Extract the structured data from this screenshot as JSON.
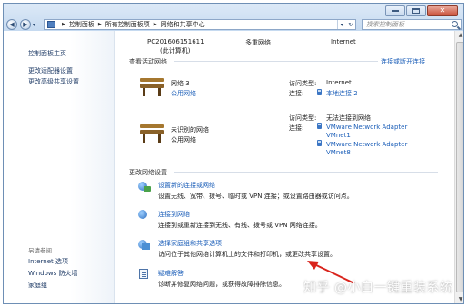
{
  "address_bar": {
    "crumbs": [
      "控制面板",
      "所有控制面板项",
      "网络和共享中心"
    ],
    "refresh_glyph": "↻"
  },
  "search": {
    "placeholder": "搜索控制面板"
  },
  "sidebar": {
    "items": [
      "控制面板主页",
      "更改适配器设置",
      "更改高级共享设置"
    ],
    "see_also_label": "另请参阅",
    "see_also": [
      "Internet 选项",
      "Windows 防火墙",
      "家庭组"
    ]
  },
  "summary_row": {
    "computer": "PC201606151611",
    "computer_note": "(此计算机)",
    "middle": "多重网络",
    "right": "Internet"
  },
  "active_networks": {
    "title": "查看活动网络",
    "connect_link": "连接或断开连接",
    "networks": [
      {
        "name": "网络 3",
        "type": "公用网络",
        "access_label": "访问类型:",
        "access_value": "Internet",
        "conn_label": "连接:",
        "conn_values": [
          "本地连接 2"
        ]
      },
      {
        "name": "未识别的网络",
        "type": "公用网络",
        "access_label": "访问类型:",
        "access_value": "无法连接到网络",
        "conn_label": "连接:",
        "conn_values": [
          "VMware Network Adapter VMnet1",
          "VMware Network Adapter VMnet8"
        ]
      }
    ]
  },
  "change_settings": {
    "title": "更改网络设置",
    "tasks": [
      {
        "link": "设置新的连接或网络",
        "desc": "设置无线、宽带、拨号、临时或 VPN 连接；或设置路由器或访问点。",
        "icon": "globe-plug-icon"
      },
      {
        "link": "连接到网络",
        "desc": "连接到或重新连接到无线、有线、拨号或 VPN 网络连接。",
        "icon": "globe-icon"
      },
      {
        "link": "选择家庭组和共享选项",
        "desc": "访问位于其他网络计算机上的文件和打印机，或更改共享设置。",
        "icon": "homegroup-icon"
      },
      {
        "link": "疑难解答",
        "desc": "诊断并修复网络问题，或获得故障排除信息。",
        "icon": "troubleshoot-icon"
      }
    ]
  },
  "watermark": "知乎 @小白一键重装系统",
  "colors": {
    "link": "#1b5eb8",
    "arrow": "#d9241c",
    "titlebar": "#c6daf0"
  }
}
